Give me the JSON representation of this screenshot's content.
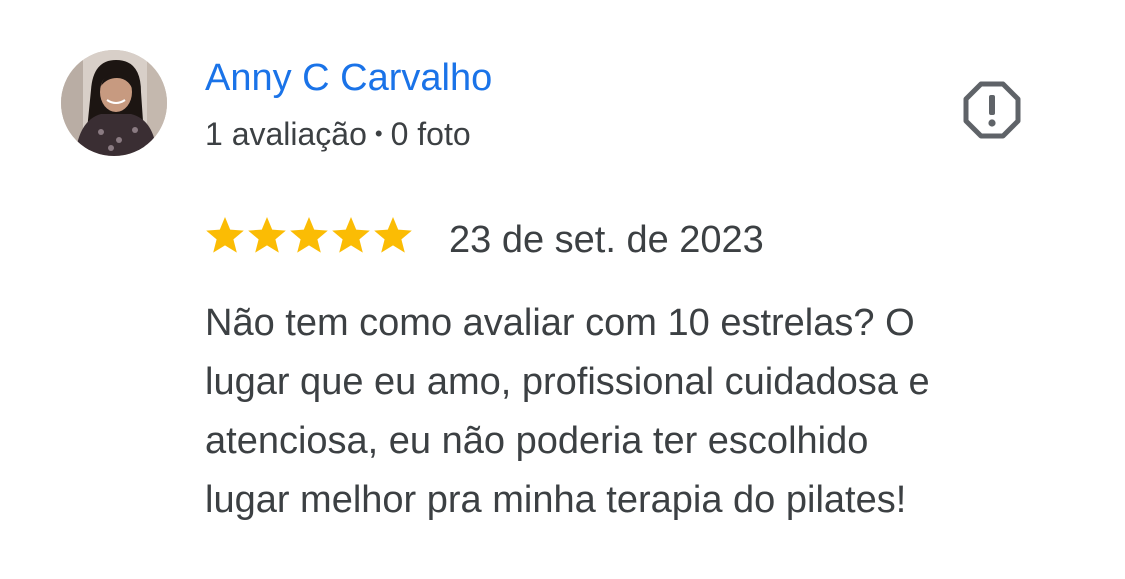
{
  "author": {
    "name": "Anny C Carvalho",
    "reviews_count": "1 avaliação",
    "separator": "•",
    "photos_count": "0 foto",
    "avatar_icon": "profile-photo"
  },
  "report": {
    "icon": "report-flag-icon"
  },
  "review": {
    "rating": 5,
    "max_rating": 5,
    "date": "23 de set. de 2023",
    "text_lines": [
      "Não tem como avaliar com 10 estrelas? O",
      "lugar que eu amo, profissional cuidadosa e",
      "atenciosa, eu não poderia ter escolhido",
      "lugar melhor pra minha terapia do pilates!"
    ]
  },
  "colors": {
    "author_name": "#1a73e8",
    "text": "#3c4043",
    "star": "#fbbc04",
    "icon": "#5f6368"
  }
}
